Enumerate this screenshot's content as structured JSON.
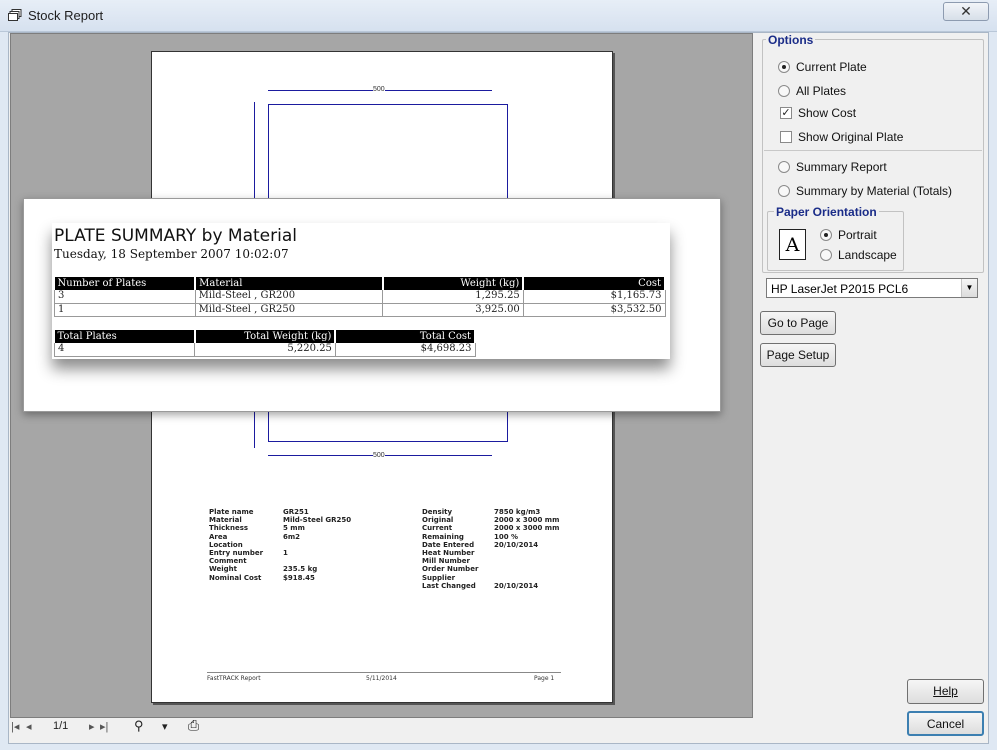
{
  "window": {
    "title": "Stock Report",
    "close_glyph": "✕"
  },
  "page": {
    "dim_top": "500",
    "dim_bottom": "500",
    "details_left": [
      {
        "k": "Plate name",
        "v": "GR251"
      },
      {
        "k": "Material",
        "v": "Mild-Steel GR250"
      },
      {
        "k": "Thickness",
        "v": "5 mm"
      },
      {
        "k": "Area",
        "v": "6m2"
      },
      {
        "k": "Location",
        "v": ""
      },
      {
        "k": "Entry number",
        "v": "  1"
      },
      {
        "k": "Comment",
        "v": ""
      },
      {
        "k": "Weight",
        "v": "235.5 kg"
      },
      {
        "k": "Nominal Cost",
        "v": "$918.45"
      }
    ],
    "details_right": [
      {
        "k": "Density",
        "v": "7850 kg/m3"
      },
      {
        "k": "Original",
        "v": "2000 x 3000 mm"
      },
      {
        "k": "Current",
        "v": "2000 x 3000 mm"
      },
      {
        "k": "Remaining",
        "v": "100 %"
      },
      {
        "k": "Date Entered",
        "v": "20/10/2014"
      },
      {
        "k": "Heat Number",
        "v": ""
      },
      {
        "k": "Mill Number",
        "v": ""
      },
      {
        "k": "Order Number",
        "v": ""
      },
      {
        "k": "Supplier",
        "v": ""
      },
      {
        "k": "Last Changed",
        "v": "20/10/2014"
      }
    ],
    "footer": {
      "left": "FastTRACK Report",
      "center": "5/11/2014",
      "right": "Page 1"
    }
  },
  "summary": {
    "title": "PLATE SUMMARY by Material",
    "date": "Tuesday, 18 September 2007  10:02:07",
    "headers": [
      "Number of Plates",
      "Material",
      "Weight (kg)",
      "Cost"
    ],
    "rows": [
      [
        "3",
        "Mild-Steel , GR200",
        "1,295.25",
        "$1,165.73"
      ],
      [
        "1",
        "Mild-Steel , GR250",
        "3,925.00",
        "$3,532.50"
      ]
    ],
    "total_headers": [
      "Total Plates",
      "Total Weight (kg)",
      "Total Cost"
    ],
    "totals": [
      "4",
      "5,220.25",
      "$4,698.23"
    ]
  },
  "options": {
    "legend": "Options",
    "current_plate": "Current Plate",
    "all_plates": "All Plates",
    "show_cost": "Show Cost",
    "show_original_plate": "Show Original Plate",
    "summary_report": "Summary Report",
    "summary_by_material": "Summary by Material (Totals)",
    "orientation_legend": "Paper Orientation",
    "portrait": "Portrait",
    "landscape": "Landscape",
    "orientation_glyph": "A",
    "printer": "HP LaserJet P2015 PCL6",
    "show_cost_mark": "✓"
  },
  "buttons": {
    "goto_page": "Go to Page",
    "page_setup": "Page Setup",
    "help": "Help",
    "cancel": "Cancel"
  },
  "nav": {
    "first": "|◂",
    "prev": "◂",
    "page": "1/1",
    "next": "▸",
    "last": "▸|",
    "zoom": "⚲",
    "zoom_drop": "▾",
    "print": "⎙"
  },
  "colors": {
    "accent": "#1a2c88",
    "preview_bg": "#a6a6a6",
    "dim_line": "#1b1b9f"
  }
}
